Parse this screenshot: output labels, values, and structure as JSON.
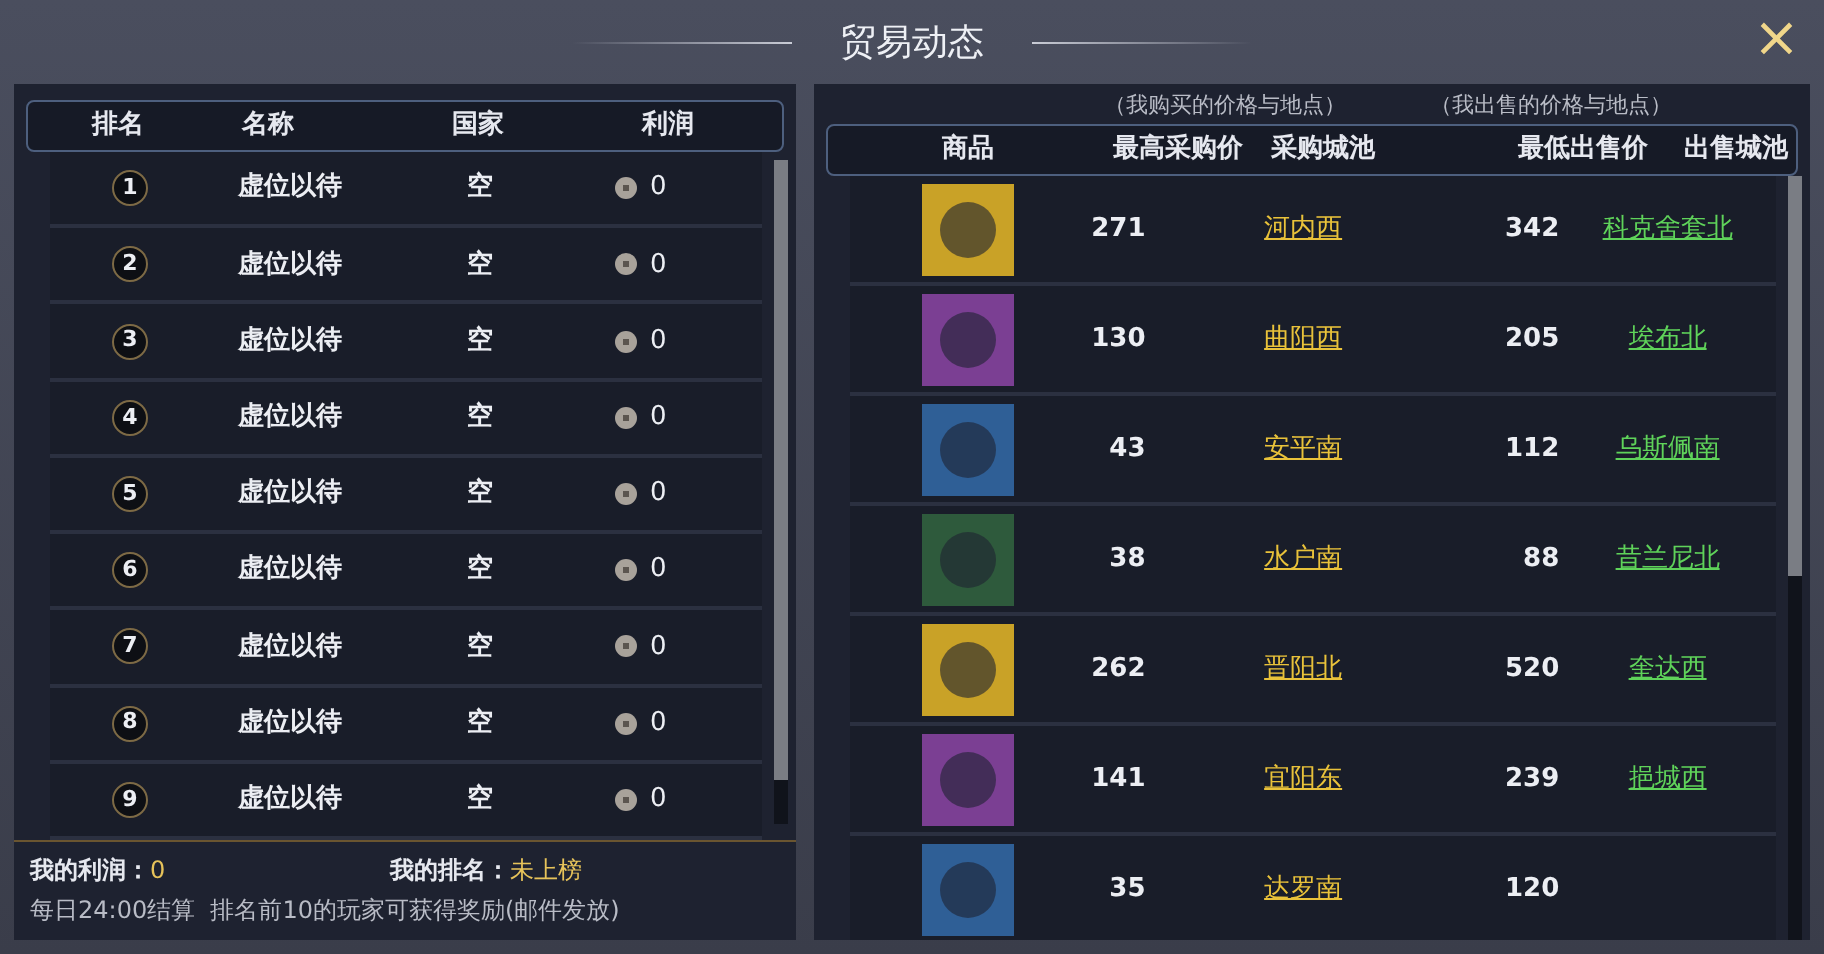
{
  "window": {
    "title": "贸易动态",
    "close": "×"
  },
  "ranking": {
    "columns": [
      "排名",
      "名称",
      "国家",
      "利润"
    ],
    "rows": [
      {
        "rank": "1",
        "name": "虚位以待",
        "country": "空",
        "profit": "0"
      },
      {
        "rank": "2",
        "name": "虚位以待",
        "country": "空",
        "profit": "0"
      },
      {
        "rank": "3",
        "name": "虚位以待",
        "country": "空",
        "profit": "0"
      },
      {
        "rank": "4",
        "name": "虚位以待",
        "country": "空",
        "profit": "0"
      },
      {
        "rank": "5",
        "name": "虚位以待",
        "country": "空",
        "profit": "0"
      },
      {
        "rank": "6",
        "name": "虚位以待",
        "country": "空",
        "profit": "0"
      },
      {
        "rank": "7",
        "name": "虚位以待",
        "country": "空",
        "profit": "0"
      },
      {
        "rank": "8",
        "name": "虚位以待",
        "country": "空",
        "profit": "0"
      },
      {
        "rank": "9",
        "name": "虚位以待",
        "country": "空",
        "profit": "0"
      }
    ],
    "my_profit_label": "我的利润：",
    "my_profit": "0",
    "my_rank_label": "我的排名：",
    "my_rank": "未上榜",
    "note": "每日24:00结算  排名前10的玩家可获得奖励(邮件发放)"
  },
  "market": {
    "buy_caption": "（我购买的价格与地点）",
    "sell_caption": "（我出售的价格与地点）",
    "columns": [
      "商品",
      "最高采购价",
      "采购城池",
      "最低出售价",
      "出售城池"
    ],
    "rows": [
      {
        "color": "#c9a227",
        "buy_price": "271",
        "buy_city": "河内西",
        "sell_price": "342",
        "sell_city": "科克舍套北"
      },
      {
        "color": "#7b3f93",
        "buy_price": "130",
        "buy_city": "曲阳西",
        "sell_price": "205",
        "sell_city": "埃布北"
      },
      {
        "color": "#2f5f96",
        "buy_price": "43",
        "buy_city": "安平南",
        "sell_price": "112",
        "sell_city": "乌斯佩南"
      },
      {
        "color": "#2e5a3c",
        "buy_price": "38",
        "buy_city": "水户南",
        "sell_price": "88",
        "sell_city": "昔兰尼北"
      },
      {
        "color": "#c9a227",
        "buy_price": "262",
        "buy_city": "晋阳北",
        "sell_price": "520",
        "sell_city": "奎达西"
      },
      {
        "color": "#7b3f93",
        "buy_price": "141",
        "buy_city": "宜阳东",
        "sell_price": "239",
        "sell_city": "挹城西"
      },
      {
        "color": "#2f5f96",
        "buy_price": "35",
        "buy_city": "达罗南",
        "sell_price": "120"
      }
    ]
  }
}
